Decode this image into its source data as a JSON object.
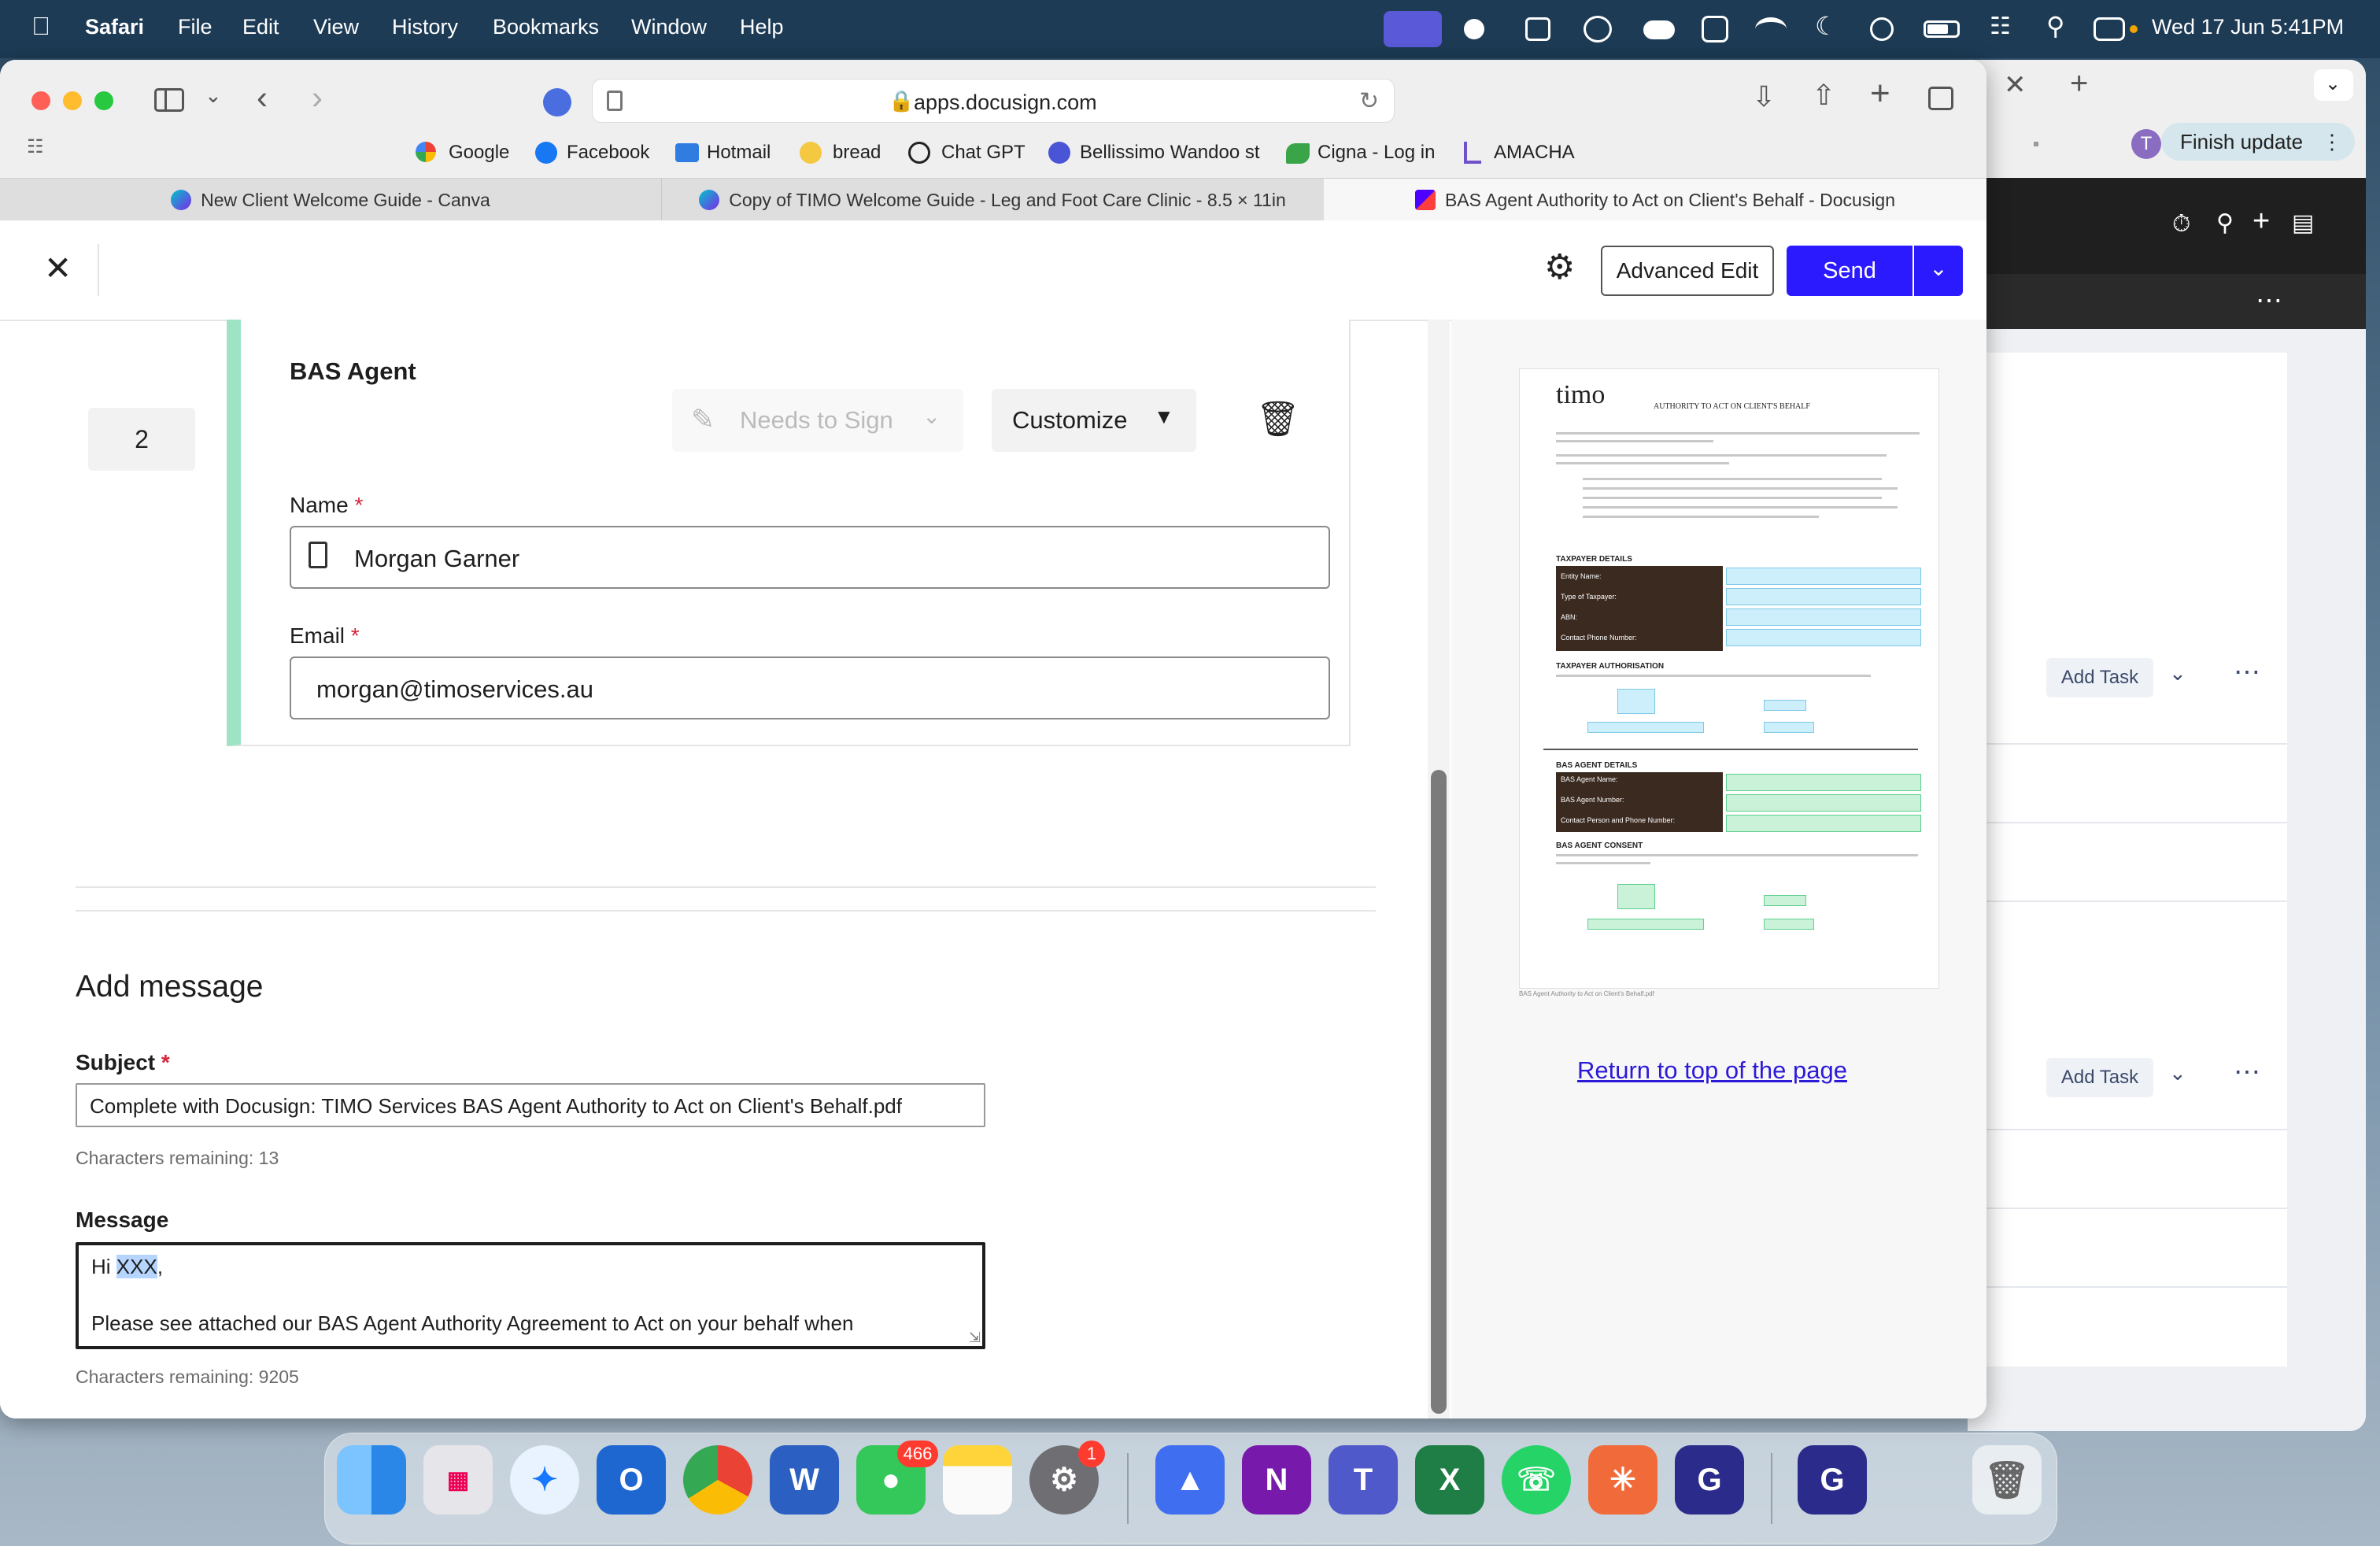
{
  "menubar": {
    "app": "Safari",
    "items": [
      "File",
      "Edit",
      "View",
      "History",
      "Bookmarks",
      "Window",
      "Help"
    ],
    "clock": "Wed 17 Jun  5:41PM"
  },
  "browser": {
    "url": "apps.docusign.com",
    "bookmarks": [
      "Google",
      "Facebook",
      "Hotmail",
      "bread",
      "Chat GPT",
      "Bellissimo Wandoo st",
      "Cigna - Log in",
      "AMACHA"
    ],
    "tabs": [
      "New Client Welcome Guide - Canva",
      "Copy of TIMO Welcome Guide - Leg and Foot Care Clinic - 8.5 × 11in",
      "BAS Agent Authority to Act on Client's Behalf - Docusign"
    ],
    "side_window": {
      "finish_update": "Finish update",
      "avatar": "T",
      "add_task_1": "Add Task",
      "add_task_2": "Add Task"
    }
  },
  "docusign": {
    "header": {
      "advanced_edit": "Advanced Edit",
      "send": "Send"
    },
    "recipient": {
      "order": "2",
      "title": "BAS Agent",
      "role": "Needs to Sign",
      "customize": "Customize",
      "name_label": "Name",
      "name_value": "Morgan Garner",
      "email_label": "Email",
      "email_value": "morgan@timoservices.au",
      "required_mark": "*"
    },
    "message": {
      "heading": "Add message",
      "subject_label": "Subject",
      "subject_value": "Complete with Docusign: TIMO Services BAS Agent Authority to Act on Client's Behalf.pdf",
      "subject_remaining": "Characters remaining: 13",
      "message_label": "Message",
      "message_line1_prefix": "Hi ",
      "message_line1_selected": "XXX",
      "message_line1_suffix": ",",
      "message_line2": "Please see attached our BAS Agent Authority Agreement to Act on your behalf when",
      "message_remaining": "Characters remaining: 9205",
      "required_mark": "*"
    },
    "preview": {
      "logo": "timo",
      "doc_title": "AUTHORITY TO ACT ON CLIENT'S BEHALF",
      "section_taxpayer_details": "TAXPAYER DETAILS",
      "taxpayer_rows": [
        "Entity Name:",
        "Type of Taxpayer:",
        "ABN:",
        "Contact Phone Number:"
      ],
      "section_taxpayer_auth": "TAXPAYER AUTHORISATION",
      "section_agent_details": "BAS AGENT DETAILS",
      "agent_rows": [
        "BAS Agent Name:",
        "BAS Agent Number:",
        "Contact Person and Phone Number:"
      ],
      "section_agent_consent": "BAS AGENT CONSENT",
      "filename": "BAS Agent Authority to Act on Client's Behalf.pdf",
      "return_link": "Return to top of the page"
    }
  },
  "dock": {
    "messages_badge": "466",
    "settings_badge": "1"
  },
  "colors": {
    "accent_blue": "#2c1aff",
    "recipient_stripe": "#9ee3c4",
    "link": "#2c1ad9",
    "menubar": "#1d3b55"
  }
}
